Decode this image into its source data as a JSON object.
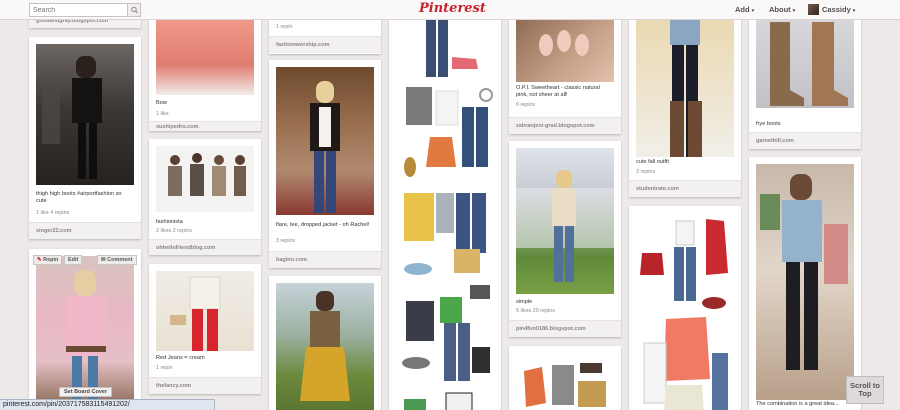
{
  "header": {
    "search_placeholder": "Search",
    "logo": "Pinterest",
    "add_label": "Add",
    "about_label": "About",
    "user_name": "Cassidy",
    "caret": "▾"
  },
  "pins": [
    {
      "source": "goodandgray.blogspot.com"
    },
    {
      "desc": "thigh high boots #airportfashion so cute",
      "stats": "1 like   4 repins",
      "source": "singer22.com"
    },
    {
      "desc": "",
      "stats": ""
    },
    {
      "desc": "Bow",
      "stats": "1 like",
      "source": "sushipedro.com"
    },
    {
      "desc": "fashionista",
      "stats": "2 likes   2 repins",
      "source": "ohhellofriendblog.com"
    },
    {
      "desc": "Red Jeans = cream",
      "stats": "1 repin",
      "source": "thefancy.com"
    },
    {
      "stats": "1 repin",
      "source": "fashionworship.com"
    },
    {
      "desc": "flare, tee, dropped jacket - oh Rachel!",
      "stats": "3 repins",
      "source": "bagino.com"
    },
    {
      "desc": "",
      "stats": ""
    },
    {
      "desc": "",
      "stats": ""
    },
    {
      "desc": "O.P.I. Sweetheart - classic natural pink, not sheer at all!",
      "stats": "6 repins",
      "source": "zabranjeni-grad.blogspot.com"
    },
    {
      "desc": "simple",
      "stats": "5 likes   29 repins",
      "source": "pin4fun0186.blogspot.com"
    },
    {
      "desc": "",
      "stats": ""
    },
    {
      "desc": "cute fall outfit",
      "stats": "3 repins",
      "source": "studentrate.com"
    },
    {
      "desc": "",
      "stats": ""
    },
    {
      "desc": "frye boots",
      "stats": "",
      "source": "garnethill.com"
    },
    {
      "desc": "The combination is a great idea...",
      "stats": ""
    }
  ],
  "hover_actions": {
    "repin": "Repin",
    "edit": "Edit",
    "comment": "Comment"
  },
  "set_board_cover": "Set Board Cover",
  "status_url": "pinterest.com/pin/20371758311549120​2/",
  "scroll_to_top": "Scroll to Top",
  "colors": {
    "brand_red": "#c8232c",
    "background": "#ece9e8"
  }
}
